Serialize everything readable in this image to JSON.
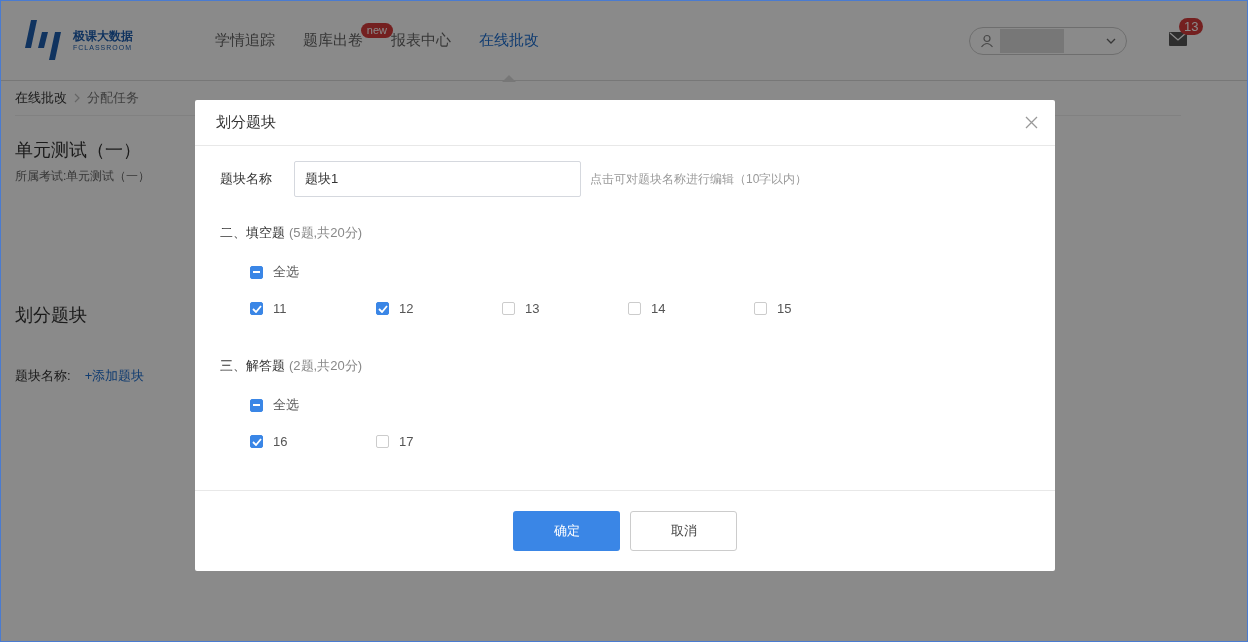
{
  "header": {
    "logo": {
      "name": "极课大数据",
      "tagline": "FCLASSROOM"
    },
    "nav": [
      {
        "label": "学情追踪",
        "selected": false
      },
      {
        "label": "题库出卷",
        "selected": false,
        "badge": "new"
      },
      {
        "label": "报表中心",
        "selected": false
      },
      {
        "label": "在线批改",
        "selected": true
      }
    ],
    "mail_badge": "13"
  },
  "breadcrumb": [
    "在线批改",
    "分配任务"
  ],
  "exam": {
    "title": "单元测试（一）",
    "subtitle": "所属考试:单元测试（一）"
  },
  "blocks_section": {
    "title": "划分题块",
    "label": "题块名称:",
    "add_link": "+添加题块"
  },
  "dialog": {
    "title": "划分题块",
    "name_label": "题块名称",
    "name_value": "题块1",
    "name_hint": "点击可对题块名称进行编辑（10字以内）",
    "groups": [
      {
        "title": "二、填空题",
        "info": "(5题,共20分)",
        "select_all": {
          "label": "全选",
          "indeterminate": true
        },
        "items": [
          {
            "label": "11",
            "checked": true
          },
          {
            "label": "12",
            "checked": true
          },
          {
            "label": "13",
            "checked": false
          },
          {
            "label": "14",
            "checked": false
          },
          {
            "label": "15",
            "checked": false
          }
        ]
      },
      {
        "title": "三、解答题",
        "info": "(2题,共20分)",
        "select_all": {
          "label": "全选",
          "indeterminate": true
        },
        "items": [
          {
            "label": "16",
            "checked": true
          },
          {
            "label": "17",
            "checked": false
          }
        ]
      }
    ],
    "buttons": [
      {
        "label": "确定",
        "kind": "primary"
      },
      {
        "label": "取消",
        "kind": "default"
      }
    ]
  }
}
